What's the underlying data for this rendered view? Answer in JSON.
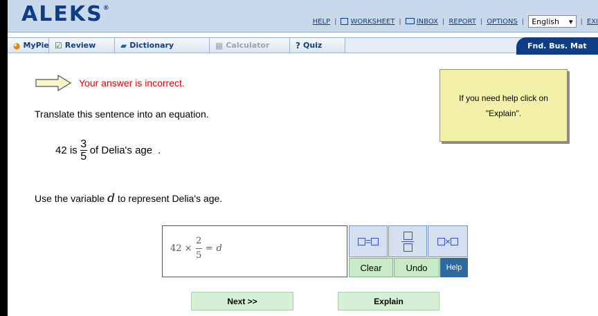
{
  "app": {
    "logo": "ALEKS",
    "trademark": "®"
  },
  "toplinks": {
    "help": "HELP",
    "worksheet": "WORKSHEET",
    "inbox": "INBOX",
    "report": "REPORT",
    "options": "OPTIONS",
    "language": "English",
    "exit": "EXI"
  },
  "nav": {
    "mypie": "MyPie",
    "review": "Review",
    "dictionary": "Dictionary",
    "calculator": "Calculator",
    "quiz": "Quiz",
    "course": "Fnd. Bus. Mat"
  },
  "feedback": {
    "text": "Your answer is incorrect."
  },
  "problem": {
    "instruction": "Translate this sentence into an equation.",
    "statement_pre": "42 is",
    "fraction_num": "3",
    "fraction_den": "5",
    "statement_post": "of Delia's age",
    "statement_end": ".",
    "variable_pre": "Use the variable",
    "variable": "d",
    "variable_post": "to represent Delia's age."
  },
  "answer": {
    "prefix": "42 ×",
    "frac_num": "2",
    "frac_den": "5",
    "eq": "=",
    "var": "d"
  },
  "toolpad": {
    "eq_sign": "=",
    "times_sign": "×",
    "clear": "Clear",
    "undo": "Undo",
    "help": "Help"
  },
  "buttons": {
    "next": "Next >>",
    "explain": "Explain"
  },
  "helpbox": {
    "line1": "If you need help click on",
    "line2": "\"Explain\"."
  },
  "colors": {
    "brand": "#0e3d86",
    "error": "#e00000",
    "button_green": "#d6f0d6",
    "note_yellow": "#f3f0a9"
  }
}
